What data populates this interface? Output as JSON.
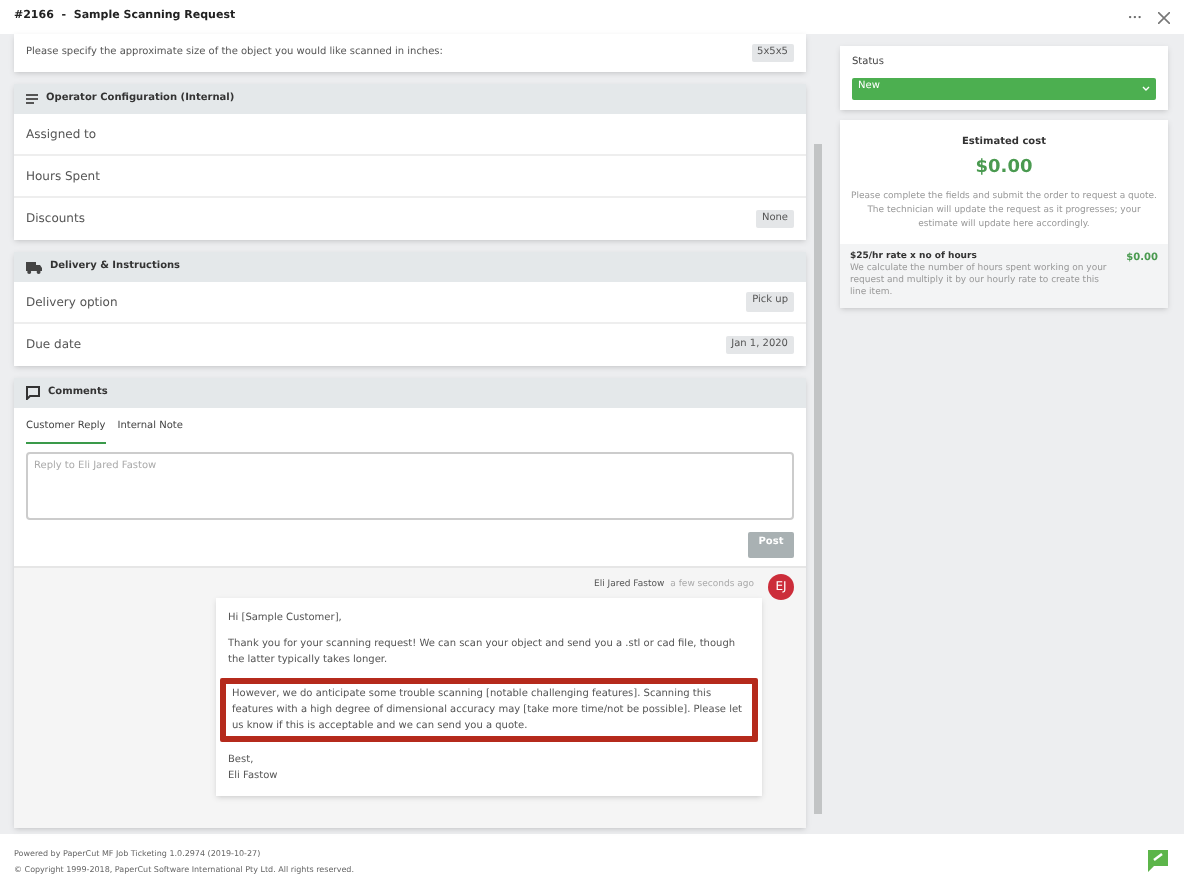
{
  "window": {
    "title": "#2166  -  Sample Scanning Request",
    "more": "•••"
  },
  "question": {
    "text": "Please specify the approximate size of the object you would like scanned in inches:",
    "value": "5x5x5"
  },
  "operator": {
    "title": "Operator Configuration (Internal)",
    "rows": [
      {
        "label": "Assigned to"
      },
      {
        "label": "Hours Spent"
      },
      {
        "label": "Discounts",
        "value": "None"
      }
    ]
  },
  "delivery": {
    "title": "Delivery & Instructions",
    "rows": [
      {
        "label": "Delivery option",
        "value": "Pick up"
      },
      {
        "label": "Due date",
        "value": "Jan 1, 2020"
      }
    ]
  },
  "comments": {
    "title": "Comments",
    "tabs": [
      {
        "label": "Customer Reply",
        "selected": true
      },
      {
        "label": "Internal Note",
        "selected": false
      }
    ],
    "reply": {
      "placeholder": "Reply to Eli Jared Fastow"
    },
    "post": {
      "label": "Post",
      "disabled": true
    },
    "message": {
      "author": "Eli Jared Fastow",
      "time": "a few seconds ago",
      "initials": "EJ",
      "paragraphs": [
        {
          "text": "Hi [Sample Customer],",
          "highlighted": false
        },
        {
          "text": "Thank you for your scanning request! We can scan your object and send you a .stl or cad file, though the latter typically takes longer.",
          "highlighted": false
        },
        {
          "text": "However, we do anticipate some trouble scanning [notable challenging features]. Scanning this features with a high degree of dimensional accuracy may [take more time/not be possible]. Please let us know if this is acceptable and we can send you a quote.",
          "highlighted": true
        },
        {
          "text": "Best,\nEli Fastow",
          "highlighted": false
        }
      ]
    }
  },
  "status": {
    "label": "Status",
    "value": "New"
  },
  "estimate": {
    "title": "Estimated cost",
    "total": "$0.00",
    "note": "Please complete the fields and submit the order to request a quote. The technician will update the request as it progresses; your estimate will update here accordingly.",
    "items": [
      {
        "name": "$25/hr rate x no of hours",
        "description": "We calculate the number of hours spent working on your request and multiply it by our hourly rate to create this line item.",
        "amount": "$0.00"
      }
    ]
  },
  "footer": {
    "lines": [
      "Powered by PaperCut MF Job Ticketing 1.0.2974 (2019-10-27)",
      "© Copyright 1999-2018, PaperCut Software International Pty Ltd. All rights reserved."
    ]
  }
}
